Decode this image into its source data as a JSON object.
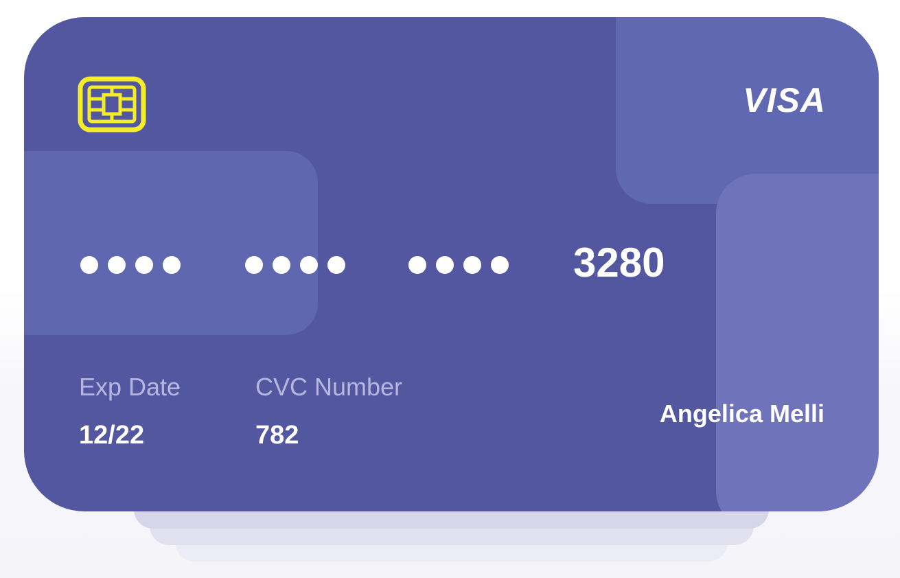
{
  "card": {
    "brand": "VISA",
    "masked_groups": [
      "••••",
      "••••",
      "••••"
    ],
    "last_four": "3280",
    "exp_label": "Exp Date",
    "exp_value": "12/22",
    "cvc_label": "CVC Number",
    "cvc_value": "782",
    "holder_name": "Angelica Melli"
  },
  "icons": {
    "chip": "chip-icon",
    "brand_logo": "visa-logo"
  },
  "colors": {
    "card_background": "#5257a0",
    "card_accent_1": "#5f67b0",
    "card_accent_2": "#6f74ba",
    "chip": "#f4ee2a",
    "label_text": "#b6b7df",
    "value_text": "#ffffff"
  }
}
